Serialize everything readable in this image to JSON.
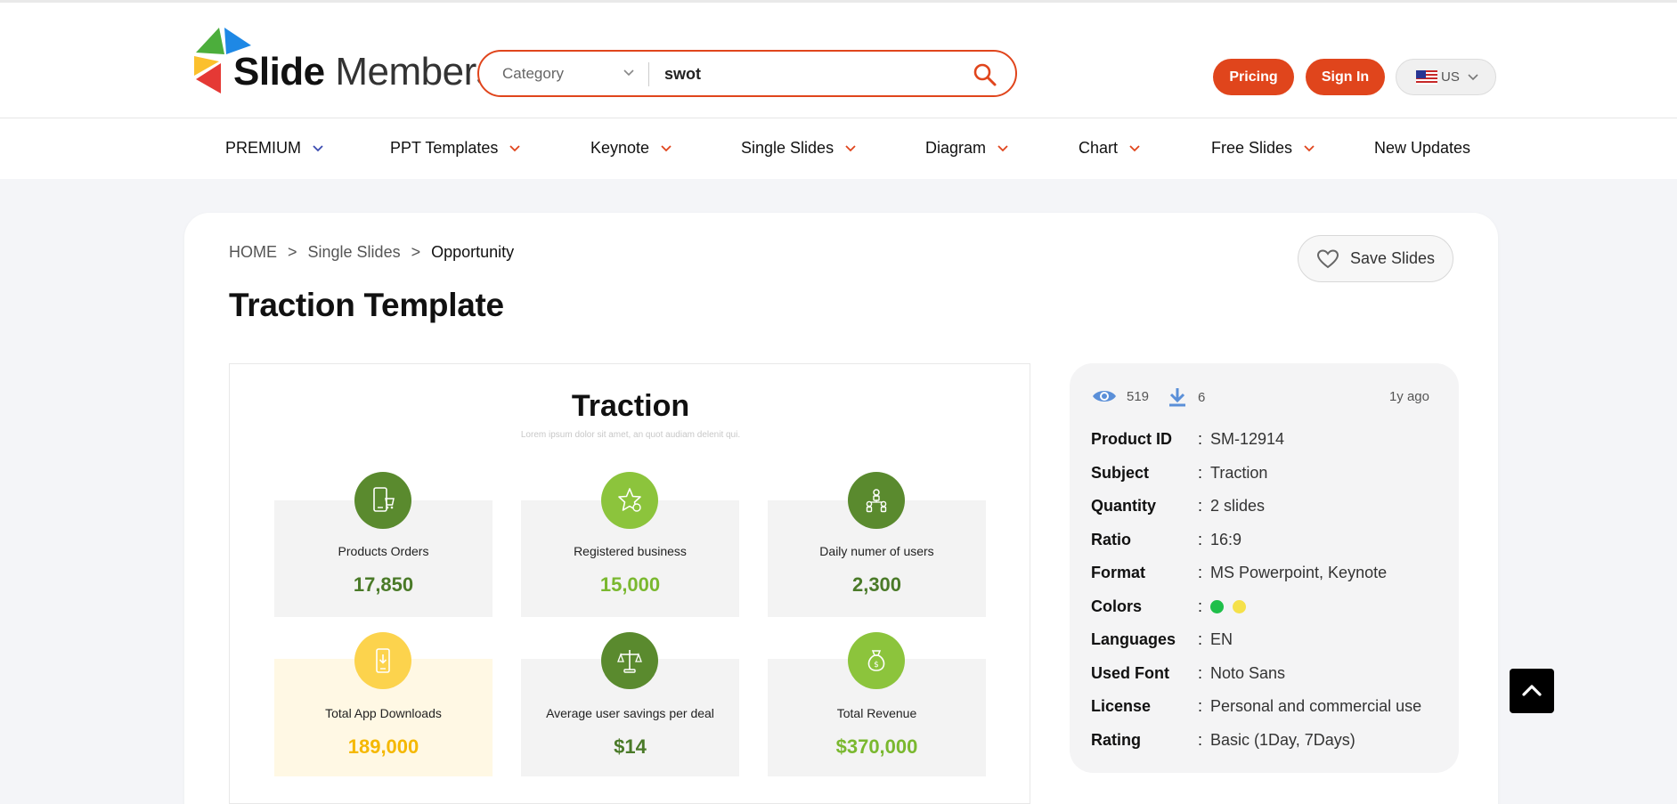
{
  "header": {
    "logo": {
      "brand_bold": "Slide",
      "brand_regular": "Members"
    },
    "search": {
      "category_label": "Category",
      "query": "swot"
    },
    "pricing_label": "Pricing",
    "signin_label": "Sign In",
    "language_label": "US"
  },
  "nav": {
    "items": [
      {
        "label": "PREMIUM",
        "chevron_color": "#3b4bb0"
      },
      {
        "label": "PPT Templates",
        "chevron_color": "#e0451c"
      },
      {
        "label": "Keynote",
        "chevron_color": "#e0451c"
      },
      {
        "label": "Single Slides",
        "chevron_color": "#e0451c"
      },
      {
        "label": "Diagram",
        "chevron_color": "#e0451c"
      },
      {
        "label": "Chart",
        "chevron_color": "#e0451c"
      },
      {
        "label": "Free Slides",
        "chevron_color": "#e0451c"
      },
      {
        "label": "New Updates"
      }
    ]
  },
  "breadcrumb": {
    "home": "HOME",
    "section": "Single Slides",
    "current": "Opportunity",
    "separator": ">"
  },
  "page_title": "Traction Template",
  "save_label": "Save Slides",
  "preview": {
    "title": "Traction",
    "subtitle": "Lorem ipsum dolor sit amet, an quot audiam delenit qui.",
    "tiles": [
      {
        "label": "Products Orders",
        "value": "17,850",
        "icon": "mobile-cart-icon",
        "circle_color": "#5a8a2e",
        "value_color": "#4a7a28"
      },
      {
        "label": "Registered business",
        "value": "15,000",
        "icon": "star-badge-icon",
        "circle_color": "#8cc43c",
        "value_color": "#7ab82f"
      },
      {
        "label": "Daily numer of users",
        "value": "2,300",
        "icon": "users-network-icon",
        "circle_color": "#5a8a2e",
        "value_color": "#4a7a28"
      },
      {
        "label": "Total App Downloads",
        "value": "189,000",
        "icon": "mobile-download-icon",
        "circle_color": "#fcd34d",
        "value_color": "#f5b800"
      },
      {
        "label": "Average user savings per deal",
        "value": "$14",
        "icon": "balance-scale-icon",
        "circle_color": "#5a8a2e",
        "value_color": "#4a7a28"
      },
      {
        "label": "Total Revenue",
        "value": "$370,000",
        "icon": "money-bag-icon",
        "circle_color": "#8cc43c",
        "value_color": "#7ab82f"
      }
    ]
  },
  "info": {
    "views": "519",
    "downloads": "6",
    "ago": "1y ago",
    "colon": ":",
    "rows": [
      {
        "key": "Product ID",
        "value": "SM-12914"
      },
      {
        "key": "Subject",
        "value": "Traction"
      },
      {
        "key": "Quantity",
        "value": "2 slides"
      },
      {
        "key": "Ratio",
        "value": "16:9"
      },
      {
        "key": "Format",
        "value": "MS Powerpoint, Keynote"
      },
      {
        "key": "Colors",
        "value": ""
      },
      {
        "key": "Languages",
        "value": "EN"
      },
      {
        "key": "Used Font",
        "value": "Noto Sans"
      },
      {
        "key": "License",
        "value": "Personal and commercial use"
      },
      {
        "key": "Rating",
        "value": "Basic (1Day, 7Days)"
      }
    ],
    "color_swatches": [
      "#1fbf4a",
      "#f5e14a"
    ]
  },
  "accent_color": "#e0451c"
}
